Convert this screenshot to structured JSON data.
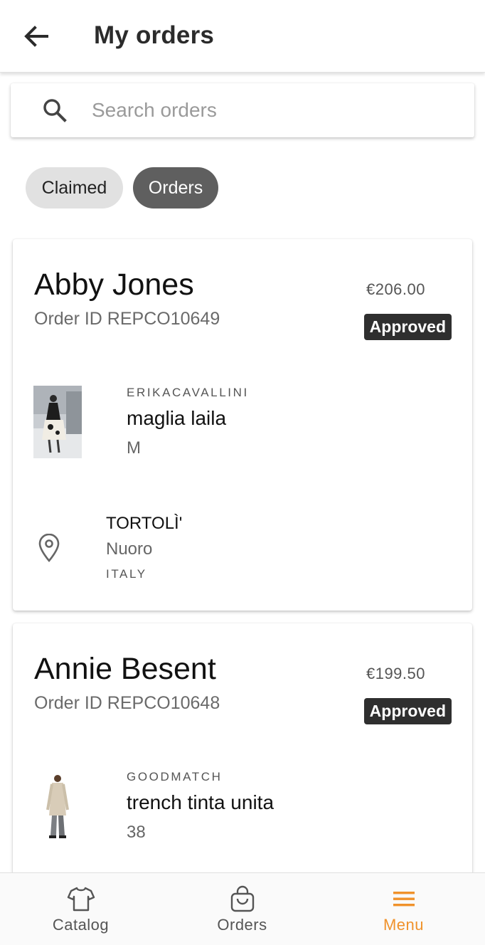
{
  "header": {
    "title": "My orders",
    "back_icon": "arrow-left-icon"
  },
  "search": {
    "placeholder": "Search orders",
    "value": "",
    "icon": "search-icon"
  },
  "filters": [
    {
      "label": "Claimed",
      "selected": false
    },
    {
      "label": "Orders",
      "selected": true
    }
  ],
  "orders": [
    {
      "customer": "Abby Jones",
      "order_id": "Order ID REPCO10649",
      "price": "€206.00",
      "status": "Approved",
      "product": {
        "brand": "ERIKACAVALLINI",
        "name": "maglia laila",
        "size": "M"
      },
      "location": {
        "city": "TORTOLÌ'",
        "province": "Nuoro",
        "country": "ITALY",
        "icon": "map-pin-icon"
      }
    },
    {
      "customer": "Annie Besent",
      "order_id": "Order ID REPCO10648",
      "price": "€199.50",
      "status": "Approved",
      "product": {
        "brand": "GOODMATCH",
        "name": "trench tinta unita",
        "size": "38"
      }
    }
  ],
  "bottom_nav": [
    {
      "label": "Catalog",
      "icon": "tshirt-icon",
      "active": false
    },
    {
      "label": "Orders",
      "icon": "shopping-bag-icon",
      "active": false
    },
    {
      "label": "Menu",
      "icon": "menu-icon",
      "active": true
    }
  ],
  "colors": {
    "accent": "#f0922b",
    "nav_inactive": "#555555",
    "badge_bg": "#2f2f2f",
    "chip_selected": "#5f5f5f",
    "chip_unselected": "#e1e1e1"
  }
}
